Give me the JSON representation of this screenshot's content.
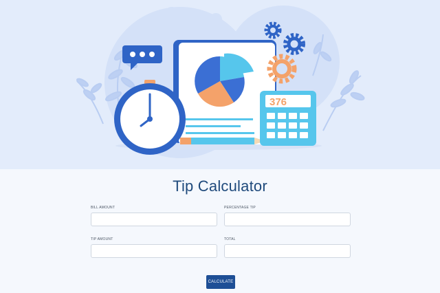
{
  "page": {
    "title": "Tip Calculator"
  },
  "illustration": {
    "calculator_display": "376",
    "icons": [
      "chat-bubble-icon",
      "stopwatch-icon",
      "pie-chart-icon",
      "gear-icon",
      "calculator-icon",
      "pencil-icon",
      "leaves-decoration"
    ]
  },
  "form": {
    "bill_amount": {
      "label": "BILL AMOUNT",
      "value": ""
    },
    "percentage_tip": {
      "label": "PERCENTAGE TIP",
      "value": ""
    },
    "tip_amount": {
      "label": "TIP AMOUNT",
      "value": ""
    },
    "total": {
      "label": "TOTAL",
      "value": ""
    },
    "submit_label": "CALCULATE"
  },
  "colors": {
    "hero_bg": "#e3ecfb",
    "primary": "#1e4f96",
    "title": "#1f4a7c",
    "accent_orange": "#f4a26a",
    "accent_cyan": "#56c6ec",
    "accent_blue": "#3b6fd4"
  }
}
